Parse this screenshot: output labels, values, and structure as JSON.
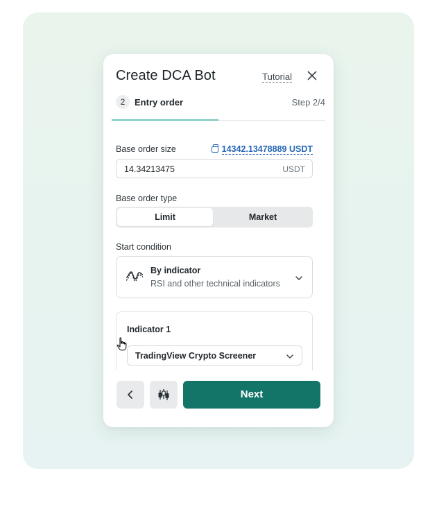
{
  "dialog": {
    "title": "Create DCA Bot",
    "tutorial_label": "Tutorial"
  },
  "stepper": {
    "step_number": "2",
    "step_label": "Entry order",
    "step_count": "Step 2/4"
  },
  "base_order_size": {
    "label": "Base order size",
    "balance": "14342.13478889 USDT",
    "value": "14.34213475",
    "unit": "USDT"
  },
  "base_order_type": {
    "label": "Base order type",
    "options": [
      "Limit",
      "Market"
    ],
    "selected": "Limit"
  },
  "start_condition": {
    "label": "Start condition",
    "selected_title": "By indicator",
    "selected_subtitle": "RSI and other technical indicators"
  },
  "indicator": {
    "title": "Indicator 1",
    "source": "TradingView Crypto Screener"
  },
  "footer": {
    "next_label": "Next"
  },
  "colors": {
    "accent": "#137468",
    "link": "#2566b8",
    "step_underline": "#6fc4b6",
    "backdrop": "#e7f3ef"
  },
  "icons": {
    "close": "close-icon",
    "wallet": "wallet-icon",
    "indicator": "indicator-wave-icon",
    "back": "chevron-left-icon",
    "settings": "candlestick-icon",
    "dropdown": "chevron-down-icon",
    "cursor": "hand-pointer-icon"
  }
}
